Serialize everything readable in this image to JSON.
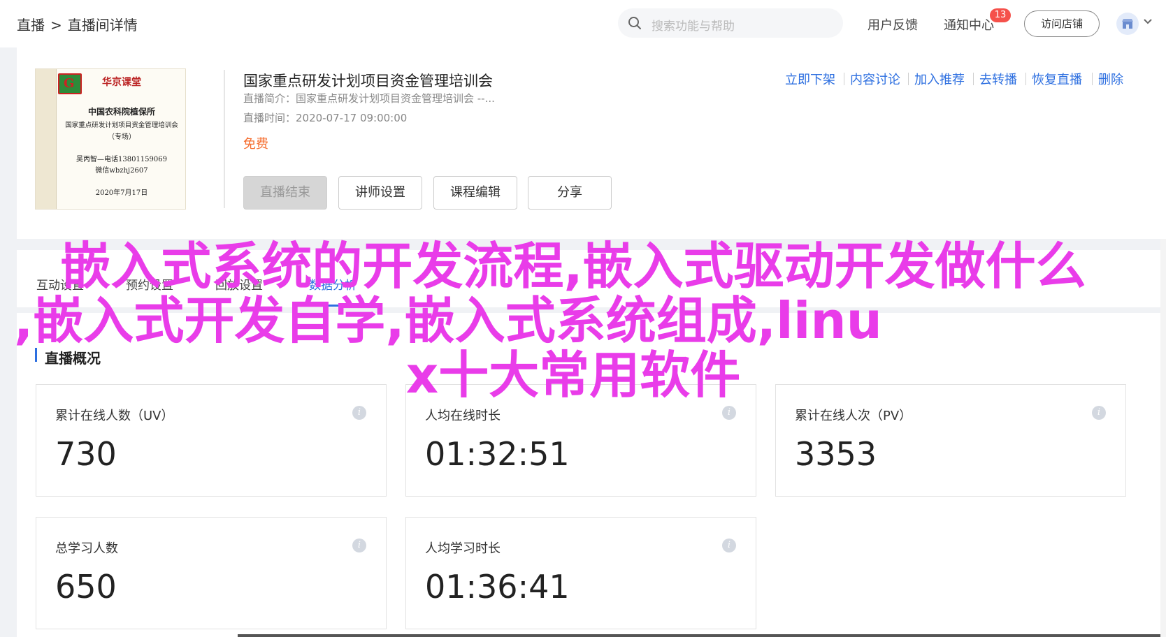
{
  "header": {
    "breadcrumb": [
      "直播",
      ">",
      "直播间详情"
    ],
    "search_placeholder": "搜索功能与帮助",
    "feedback": "用户反馈",
    "notifications": "通知中心",
    "notification_count": "13",
    "visit_store": "访问店铺"
  },
  "course": {
    "poster": {
      "brand": "华京课堂",
      "org": "中国农科院植保所",
      "title": "国家重点研发计划项目资金管理培训会",
      "tag": "（专场）",
      "contact": "吴丙智—电话13801159069",
      "wechat": "微信wbzhj2607",
      "date": "2020年7月17日"
    },
    "title": "国家重点研发计划项目资金管理培训会",
    "intro": "直播简介：国家重点研发计划项目资金管理培训会 --...",
    "time": "直播时间：2020-07-17 09:00:00",
    "price": "免费",
    "buttons": {
      "end_live": "直播结束",
      "lecturer": "讲师设置",
      "edit": "课程编辑",
      "share": "分享"
    },
    "actions": [
      "立即下架",
      "内容讨论",
      "加入推荐",
      "去转播",
      "恢复直播",
      "删除"
    ]
  },
  "tabs": [
    "互动设置",
    "预约设置",
    "回放设置",
    "数据分析"
  ],
  "active_tab": 3,
  "section_title": "直播概况",
  "stats": [
    {
      "label": "累计在线人数（UV）",
      "value": "730"
    },
    {
      "label": "人均在线时长",
      "value": "01:32:51"
    },
    {
      "label": "累计在线人次（PV）",
      "value": "3353"
    },
    {
      "label": "总学习人数",
      "value": "650"
    },
    {
      "label": "人均学习时长",
      "value": "01:36:41"
    }
  ],
  "overlay_text": {
    "line1": "嵌入式系统的开发流程,嵌入式驱动开发做什么",
    "line2": ",嵌入式开发自学,嵌入式系统组成,linu",
    "line3": "x十大常用软件"
  },
  "colors": {
    "accent": "#2d6fe0",
    "price": "#f56c2d",
    "badge": "#f5514b",
    "overlay": "#e93ce9"
  },
  "icons": [
    "search-icon",
    "store-icon",
    "chevron-down-icon",
    "info-icon"
  ]
}
